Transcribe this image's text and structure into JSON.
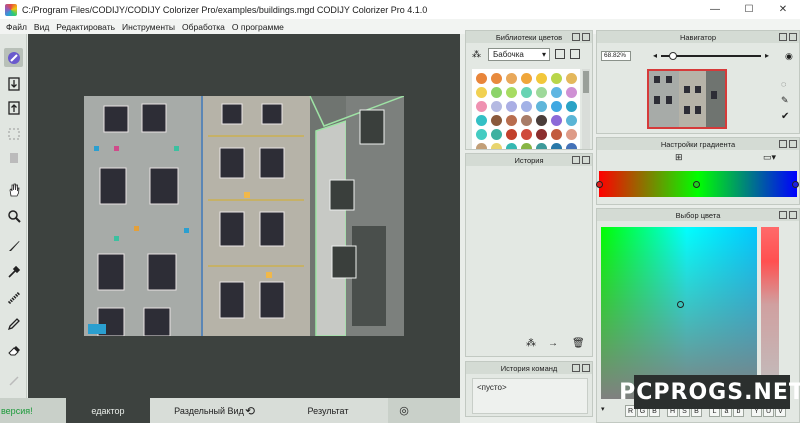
{
  "window": {
    "title": "C:/Program Files/CODIJY/CODIJY Colorizer Pro/examples/buildings.mgd CODIJY Colorizer Pro 4.1.0",
    "minimize": "—",
    "maximize": "☐",
    "close": "✕"
  },
  "menu": [
    "Файл",
    "Вид",
    "Редактировать",
    "Инструменты",
    "Обработка",
    "О программе"
  ],
  "tools": [
    "brush-color-icon",
    "import-icon",
    "export-icon",
    "selection-icon",
    "hand-icon",
    "zoom-icon",
    "brush-icon",
    "dropper-icon",
    "texture-icon",
    "pencil-icon",
    "eraser-icon",
    "pen-icon"
  ],
  "bottom_tabs": {
    "left_status": "версия!",
    "editor": "едактор",
    "split": "Раздельный Вид",
    "result": "Результат"
  },
  "color_library": {
    "title": "Библиотеки цветов",
    "selected": "Бабочка",
    "swatches": [
      "#e8853a",
      "#e88a3d",
      "#e8a85a",
      "#f0a63a",
      "#f2c73b",
      "#b9d64a",
      "#e4b85c",
      "#f1d152",
      "#8cd36a",
      "#a7dc62",
      "#68d3b3",
      "#9ed99a",
      "#5fb6e2",
      "#cf90d4",
      "#ef91b1",
      "#b4b9e2",
      "#aaaee4",
      "#a2b1e6",
      "#5fb6da",
      "#3fa8e2",
      "#2aa3c6",
      "#34c0c5",
      "#8b5a3c",
      "#b86d4e",
      "#a87c68",
      "#4a3d3a",
      "#8c6ad8",
      "#5bb5d6",
      "#44ccc2",
      "#3eb1a0",
      "#c2402b",
      "#cf4a3b",
      "#8c2e2e",
      "#c25b3e",
      "#de9b88",
      "#c29f78",
      "#e8d46f",
      "#35b8b2",
      "#87b545",
      "#3d9a9a",
      "#2978a8",
      "#4472b8"
    ]
  },
  "history": {
    "title": "История"
  },
  "command_history": {
    "title": "История команд",
    "item": "<пусто>"
  },
  "navigator": {
    "title": "Навигатор",
    "zoom": "68.82%",
    "zoom_level": 0.12
  },
  "gradient": {
    "title": "Настройки градиента"
  },
  "color_picker": {
    "title": "Выбор цвета",
    "modes": [
      "R",
      "G",
      "B",
      "H",
      "S",
      "B",
      "L",
      "a",
      "b",
      "Y",
      "U",
      "V"
    ]
  },
  "watermark": "PCPROGS.NET"
}
